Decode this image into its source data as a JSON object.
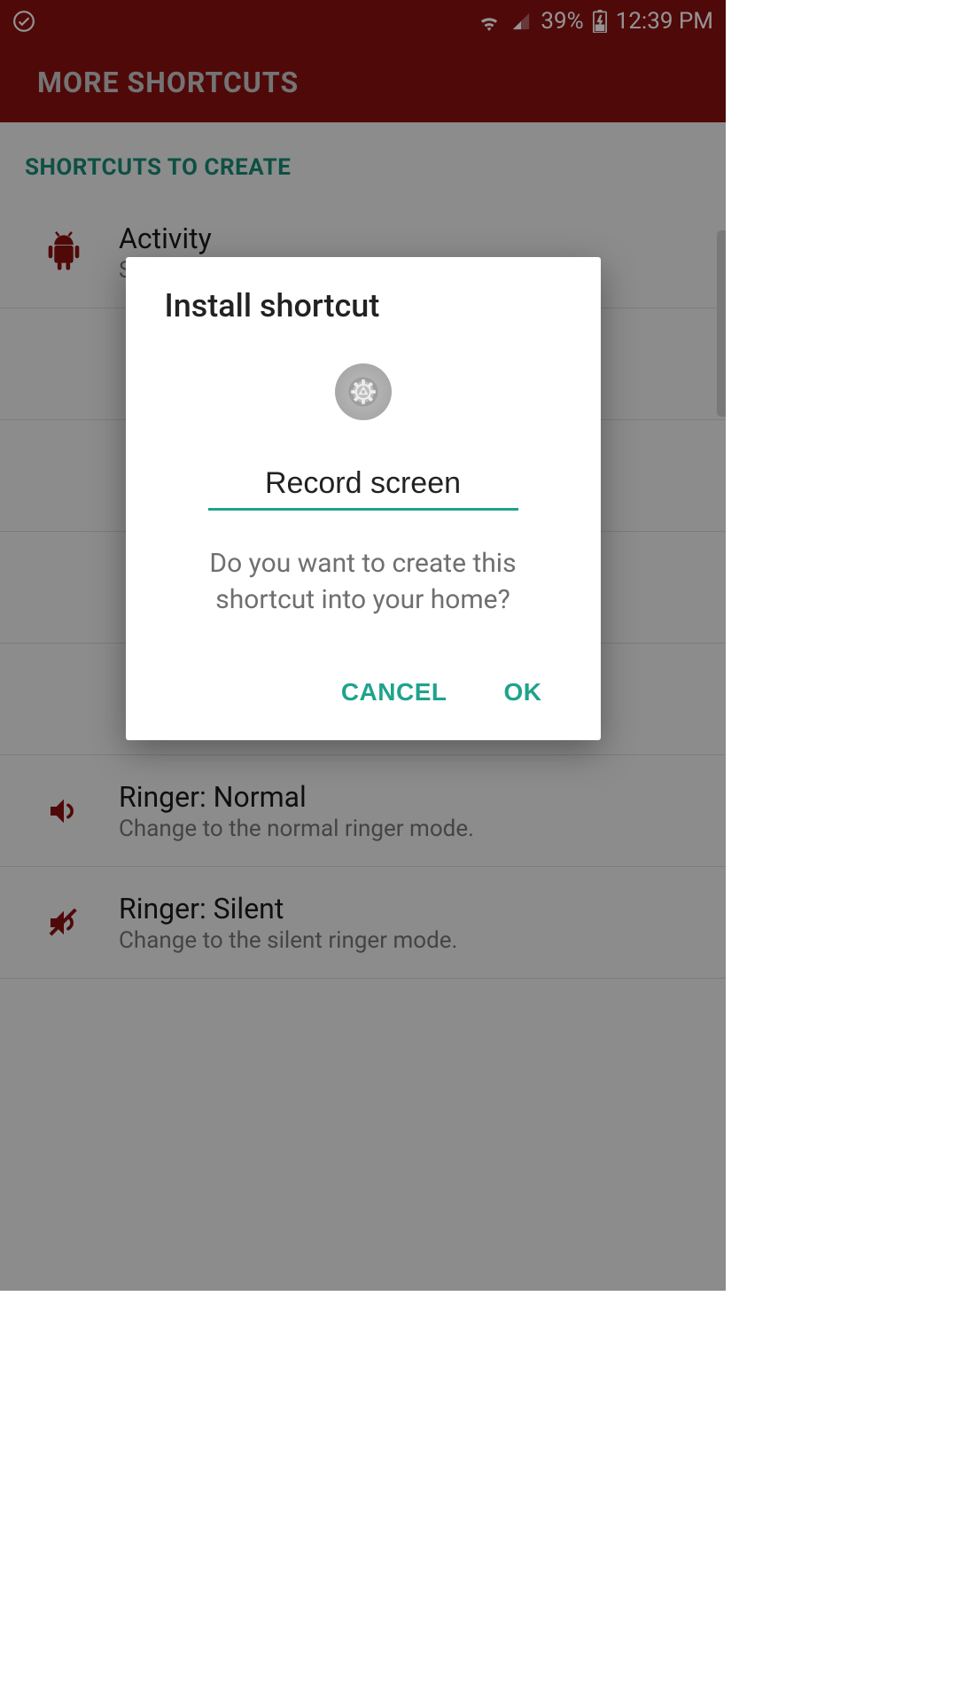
{
  "status": {
    "battery": "39%",
    "time": "12:39 PM"
  },
  "header": {
    "title": "MORE SHORTCUTS"
  },
  "section": {
    "label": "SHORTCUTS TO CREATE"
  },
  "list": {
    "items": [
      {
        "title": "Activity",
        "sub": "Select an activity to launch."
      },
      {
        "title": "",
        "sub": ""
      },
      {
        "title": "",
        "sub": ""
      },
      {
        "title": "",
        "sub": ""
      },
      {
        "title": "",
        "sub": ""
      },
      {
        "title": "Ringer: Normal",
        "sub": "Change to the normal ringer mode."
      },
      {
        "title": "Ringer: Silent",
        "sub": "Change to the silent ringer mode."
      }
    ]
  },
  "dialog": {
    "title": "Install shortcut",
    "input_value": "Record screen",
    "message": "Do you want to create this shortcut into your home?",
    "cancel": "CANCEL",
    "ok": "OK"
  }
}
